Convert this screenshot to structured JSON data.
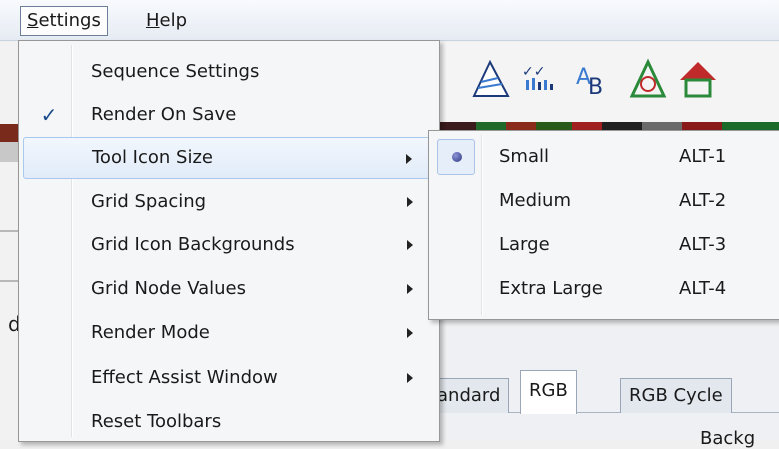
{
  "menubar": {
    "settings_label": "Settings",
    "settings_mnemonic": "S",
    "settings_rest": "ettings",
    "help_mnemonic": "H",
    "help_rest": "elp"
  },
  "settings_menu": {
    "items": [
      {
        "label": "Sequence Settings",
        "checked": false,
        "has_submenu": false
      },
      {
        "label": "Render On Save",
        "checked": true,
        "has_submenu": false
      },
      {
        "label": "Tool Icon Size",
        "checked": false,
        "has_submenu": true,
        "highlighted": true
      },
      {
        "label": "Grid Spacing",
        "checked": false,
        "has_submenu": true
      },
      {
        "label": "Grid Icon Backgrounds",
        "checked": false,
        "has_submenu": true
      },
      {
        "label": "Grid Node Values",
        "checked": false,
        "has_submenu": true
      },
      {
        "label": "Render Mode",
        "checked": false,
        "has_submenu": true
      },
      {
        "label": "Effect Assist Window",
        "checked": false,
        "has_submenu": true
      },
      {
        "label": "Reset Toolbars",
        "checked": false,
        "has_submenu": false
      }
    ],
    "check_glyph": "✓"
  },
  "tool_icon_size_submenu": {
    "items": [
      {
        "label": "Small",
        "shortcut": "ALT-1",
        "selected": true
      },
      {
        "label": "Medium",
        "shortcut": "ALT-2",
        "selected": false
      },
      {
        "label": "Large",
        "shortcut": "ALT-3",
        "selected": false
      },
      {
        "label": "Extra Large",
        "shortcut": "ALT-4",
        "selected": false
      }
    ]
  },
  "background": {
    "left_letter": "d",
    "tabs": [
      "andard",
      "RGB",
      "RGB Cycle"
    ],
    "selected_tab": "RGB",
    "bottom_text": "Backg"
  },
  "colors": {
    "accent": "#1a4c8c",
    "highlight_border": "#a8c8ec",
    "menu_bg": "#f5f6f7"
  }
}
